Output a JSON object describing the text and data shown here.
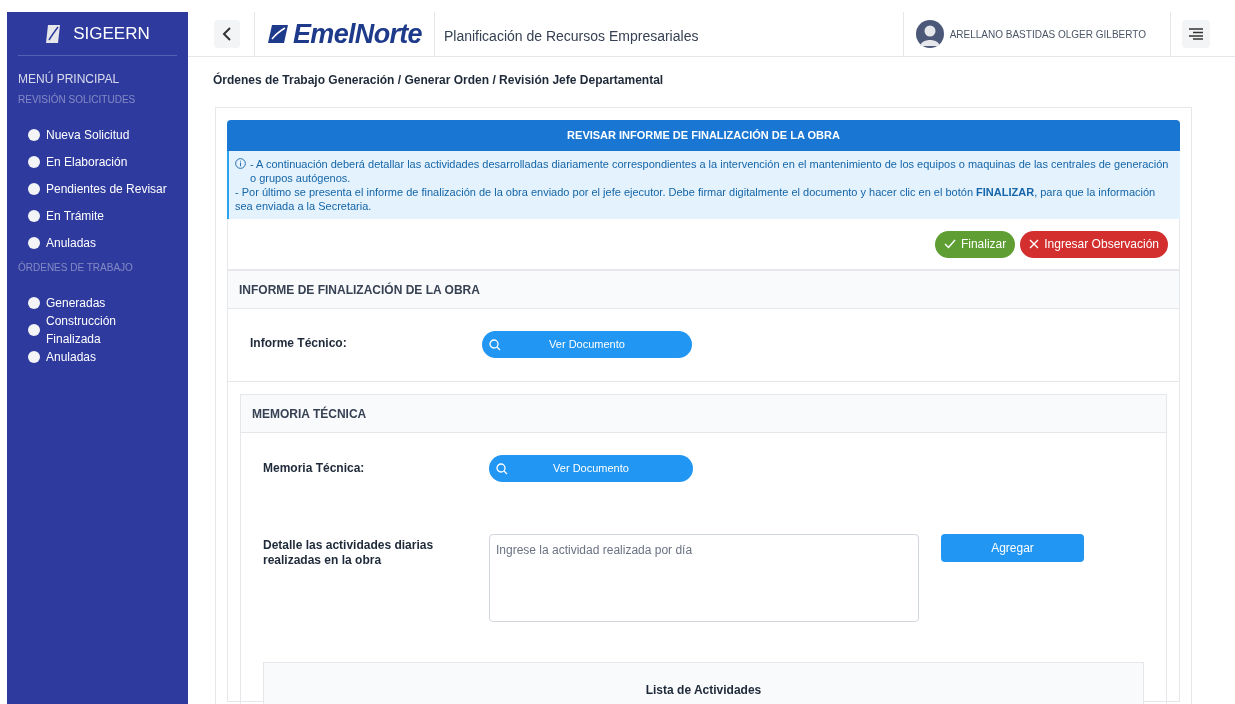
{
  "sidebar": {
    "brand": "SIGEERN",
    "menu_title": "MENÚ PRINCIPAL",
    "groups": [
      {
        "heading": "REVISIÓN SOLICITUDES",
        "items": [
          "Nueva Solicitud",
          "En Elaboración",
          "Pendientes de Revisar",
          "En Trámite",
          "Anuladas"
        ]
      },
      {
        "heading": "ÓRDENES DE TRABAJO",
        "items": [
          "Generadas",
          "Construcción Finalizada",
          "Anuladas"
        ]
      }
    ]
  },
  "header": {
    "logo": "EmelNorte",
    "subtitle": "Planificación de Recursos Empresariales",
    "user": "ARELLANO BASTIDAS OLGER GILBERTO"
  },
  "breadcrumb": "Órdenes de Trabajo Generación / Generar Orden / Revisión Jefe Departamental",
  "review": {
    "title": "REVISAR INFORME DE FINALIZACIÓN DE LA OBRA",
    "info": [
      "- A continuación deberá detallar las actividades desarrolladas diariamente correspondientes a la intervención en el mantenimiento de los equipos o maquinas de las centrales de generación o grupos autógenos.",
      "- Por último se presenta el informe de finalización de la obra enviado por el jefe ejecutor. Debe firmar digitalmente el documento y hacer clic en el botón **FINALIZAR**, para que la información sea enviada a la Secretaria."
    ],
    "buttons": [
      {
        "label": "Finalizar",
        "kind": "confirm"
      },
      {
        "label": "Ingresar Observación",
        "kind": "reject"
      }
    ]
  },
  "informe": {
    "heading": "INFORME DE FINALIZACIÓN DE LA OBRA",
    "label": "Informe Técnico:",
    "button": "Ver Documento"
  },
  "memoria": {
    "heading": "MEMORIA TÉCNICA",
    "label": "Memoria Técnica:",
    "button": "Ver Documento",
    "detail_label": "Detalle las actividades diarias realizadas en la obra",
    "placeholder": "Ingrese la actividad realizada por día",
    "add_button": "Agregar",
    "list_heading": "Lista de Actividades"
  }
}
